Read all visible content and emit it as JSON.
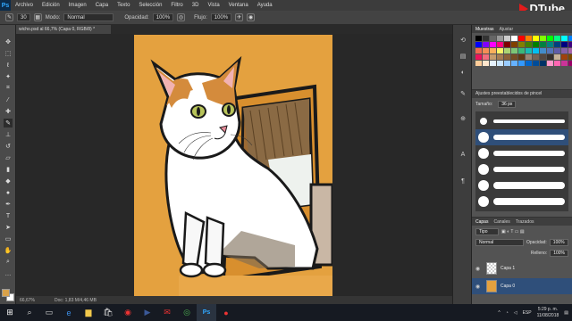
{
  "menubar": {
    "logo": "Ps",
    "items": [
      "Archivo",
      "Edición",
      "Imagen",
      "Capa",
      "Texto",
      "Selección",
      "Filtro",
      "3D",
      "Vista",
      "Ventana",
      "Ayuda"
    ],
    "watermark": "DTube"
  },
  "options": {
    "brush_size": "30",
    "mode_label": "Modo:",
    "mode_value": "Normal",
    "opacity_label": "Opacidad:",
    "opacity_value": "100%",
    "flow_label": "Flujo:",
    "flow_value": "100%"
  },
  "document": {
    "tab_title": "wicho.psd al 66,7% (Capa 0, RGB/8) *",
    "zoom": "66,67%",
    "doc_info": "Doc: 1,83 M/4,46 MB"
  },
  "swatches_panel": {
    "tabs": [
      "Muestras",
      "Ajustar"
    ],
    "colors": [
      "#000000",
      "#333333",
      "#666666",
      "#999999",
      "#cccccc",
      "#ffffff",
      "#ff0000",
      "#ff8000",
      "#ffff00",
      "#80ff00",
      "#00ff00",
      "#00ff80",
      "#00ffff",
      "#0080ff",
      "#0000ff",
      "#8000ff",
      "#ff00ff",
      "#ff0080",
      "#800000",
      "#804000",
      "#808000",
      "#408000",
      "#008000",
      "#008040",
      "#008080",
      "#004080",
      "#000080",
      "#400080",
      "#f26c4f",
      "#f68e55",
      "#fbaf5c",
      "#fff467",
      "#acd372",
      "#7cc576",
      "#3bb878",
      "#1abbb4",
      "#00bff3",
      "#438ccb",
      "#5574b9",
      "#605ca8",
      "#855fa8",
      "#a763a8",
      "#ed145b",
      "#f26d7d",
      "#c69c6d",
      "#a67c52",
      "#8c6239",
      "#754c24",
      "#603913",
      "#998675",
      "#736357",
      "#534741",
      "#362f2d",
      "#c7b299",
      "#a0410d",
      "#7d4900",
      "#ffcc99",
      "#ffe6cc",
      "#e6f2ff",
      "#cce6ff",
      "#99ccff",
      "#66b2ff",
      "#3399ff",
      "#0066cc",
      "#004c99",
      "#003366",
      "#ff99cc",
      "#ff66b2",
      "#cc3399",
      "#990066"
    ]
  },
  "brush_panel": {
    "title": "Ajustes preestablecidos de pincel",
    "size_label": "Tamaño:",
    "size_value": "36 px"
  },
  "layers_panel": {
    "tabs": [
      "Capas",
      "Canales",
      "Trazados"
    ],
    "kind_label": "Tipo",
    "blend_mode": "Normal",
    "opacity_label": "Opacidad:",
    "opacity_value": "100%",
    "fill_label": "Relleno:",
    "fill_value": "100%",
    "layers": [
      {
        "name": "Capa 1",
        "selected": false
      },
      {
        "name": "Capa 0",
        "selected": true
      }
    ]
  },
  "taskbar": {
    "language": "ESP",
    "time": "5:29 p. m.",
    "date": "11/08/2018"
  }
}
